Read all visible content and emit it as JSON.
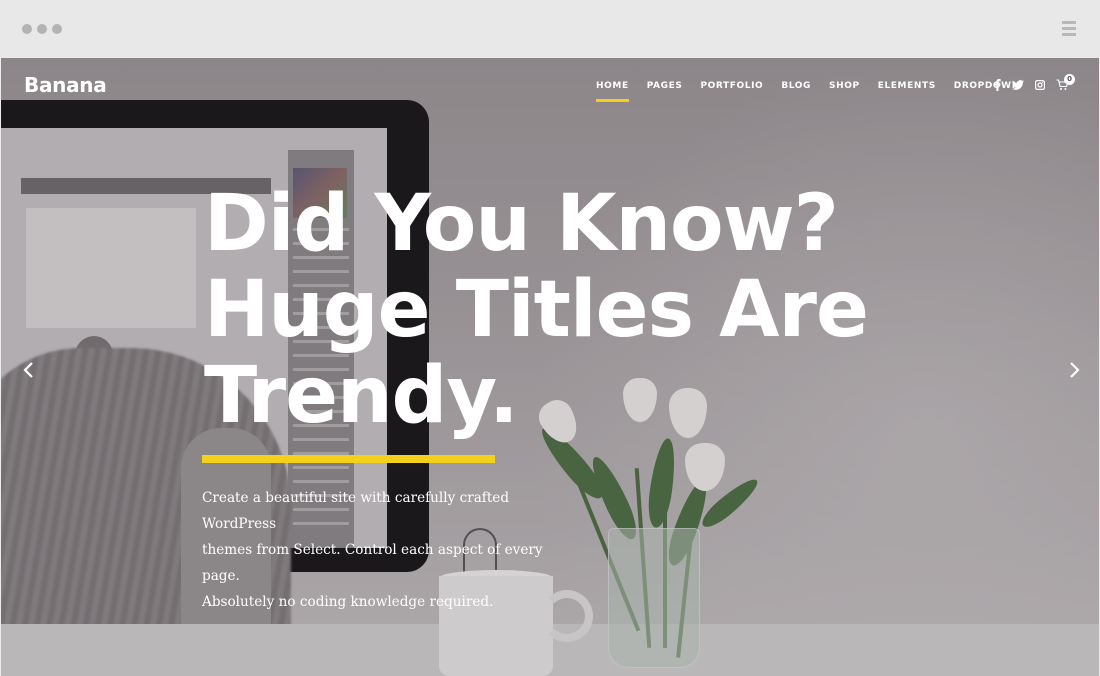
{
  "site": {
    "logo": "Banana",
    "accent_color": "#f3d019"
  },
  "nav": {
    "items": [
      {
        "label": "HOME",
        "active": true
      },
      {
        "label": "PAGES",
        "active": false
      },
      {
        "label": "PORTFOLIO",
        "active": false
      },
      {
        "label": "BLOG",
        "active": false
      },
      {
        "label": "SHOP",
        "active": false
      },
      {
        "label": "ELEMENTS",
        "active": false
      },
      {
        "label": "DROPDOWN",
        "active": false
      }
    ],
    "social_icons": [
      "facebook-icon",
      "twitter-icon",
      "instagram-icon"
    ],
    "cart": {
      "icon": "cart-icon",
      "count": "0"
    }
  },
  "hero": {
    "title_lines": [
      "Did You Know?",
      "Huge Titles Are",
      "Trendy."
    ],
    "description_lines": [
      "Create a beautiful site with carefully crafted WordPress",
      "themes from Select. Control each aspect of every page.",
      "Absolutely no coding knowledge required."
    ],
    "prev_icon": "chevron-left-icon",
    "next_icon": "chevron-right-icon"
  },
  "browser": {
    "dots_icon": "window-dots-icon",
    "menu_icon": "hamburger-icon"
  }
}
